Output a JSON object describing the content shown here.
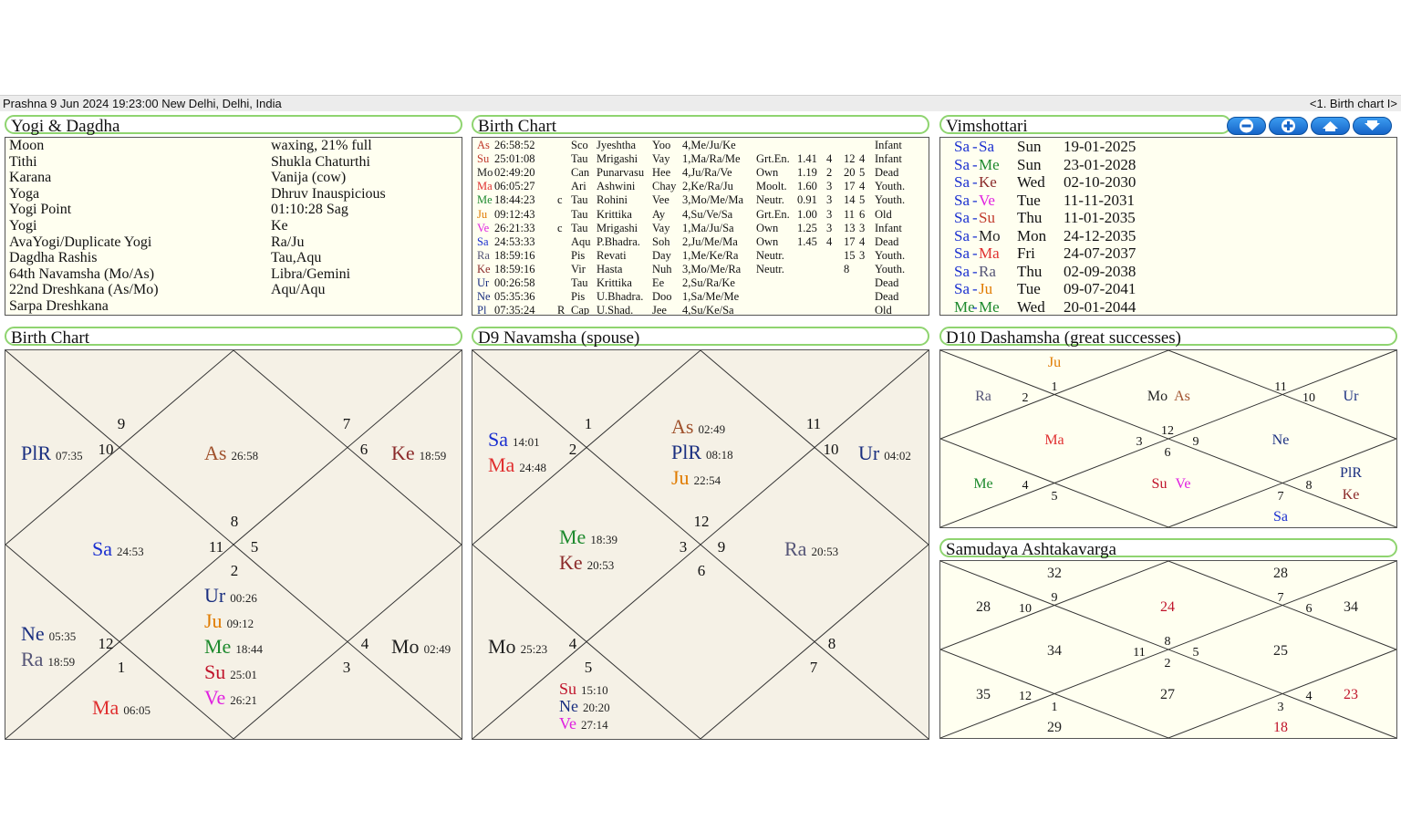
{
  "status": {
    "left": "Prashna 9 Jun 2024 19:23:00  New Delhi, Delhi, India",
    "right": "<1. Birth chart I>"
  },
  "yogi": {
    "title": "Yogi & Dagdha",
    "rows": [
      {
        "label": "Moon",
        "value": "waxing, 21% full"
      },
      {
        "label": "Tithi",
        "value": "Shukla Chaturthi"
      },
      {
        "label": "Karana",
        "value": "Vanija (cow)"
      },
      {
        "label": "Yoga",
        "value": "Dhruv Inauspicious"
      },
      {
        "label": "Yogi Point",
        "value": "01:10:28 Sag"
      },
      {
        "label": "Yogi",
        "value": "Ke"
      },
      {
        "label": "AvaYogi/Duplicate Yogi",
        "value": "Ra/Ju"
      },
      {
        "label": "Dagdha Rashis",
        "value": "Tau,Aqu"
      },
      {
        "label": "64th Navamsha (Mo/As)",
        "value": "Libra/Gemini"
      },
      {
        "label": "22nd Dreshkana (As/Mo)",
        "value": "Aqu/Aqu"
      },
      {
        "label": "Sarpa Dreshkana",
        "value": ""
      }
    ]
  },
  "birth_table": {
    "title": "Birth Chart",
    "rows": [
      {
        "p": "As",
        "c": "#c0392b",
        "deg": "26:58:52",
        "r": "",
        "sign": "Sco",
        "nak": "Jyeshtha",
        "syl": "Yoo",
        "pada": "4,Me/Ju/Ke",
        "dig": "",
        "s1": "",
        "s2": "",
        "s3": "",
        "s4": "",
        "av": "Infant"
      },
      {
        "p": "Su",
        "c": "#c0392b",
        "deg": "25:01:08",
        "r": "",
        "sign": "Tau",
        "nak": "Mrigashi",
        "syl": "Vay",
        "pada": "1,Ma/Ra/Me",
        "dig": "Grt.En.",
        "s1": "1.41",
        "s2": "4",
        "s3": "12",
        "s4": "4",
        "av": "Infant"
      },
      {
        "p": "Mo",
        "c": "#222222",
        "deg": "02:49:20",
        "r": "",
        "sign": "Can",
        "nak": "Punarvasu",
        "syl": "Hee",
        "pada": "4,Ju/Ra/Ve",
        "dig": "Own",
        "s1": "1.19",
        "s2": "2",
        "s3": "20",
        "s4": "5",
        "av": "Dead"
      },
      {
        "p": "Ma",
        "c": "#e03030",
        "deg": "06:05:27",
        "r": "",
        "sign": "Ari",
        "nak": "Ashwini",
        "syl": "Chay",
        "pada": "2,Ke/Ra/Ju",
        "dig": "Moolt.",
        "s1": "1.60",
        "s2": "3",
        "s3": "17",
        "s4": "4",
        "av": "Youth."
      },
      {
        "p": "Me",
        "c": "#1e8a2e",
        "deg": "18:44:23",
        "r": "c",
        "sign": "Tau",
        "nak": "Rohini",
        "syl": "Vee",
        "pada": "3,Mo/Me/Ma",
        "dig": "Neutr.",
        "s1": "0.91",
        "s2": "3",
        "s3": "14",
        "s4": "5",
        "av": "Youth."
      },
      {
        "p": "Ju",
        "c": "#e07b00",
        "deg": "09:12:43",
        "r": "",
        "sign": "Tau",
        "nak": "Krittika",
        "syl": "Ay",
        "pada": "4,Su/Ve/Sa",
        "dig": "Grt.En.",
        "s1": "1.00",
        "s2": "3",
        "s3": "11",
        "s4": "6",
        "av": "Old"
      },
      {
        "p": "Ve",
        "c": "#e020e0",
        "deg": "26:21:33",
        "r": "c",
        "sign": "Tau",
        "nak": "Mrigashi",
        "syl": "Vay",
        "pada": "1,Ma/Ju/Sa",
        "dig": "Own",
        "s1": "1.25",
        "s2": "3",
        "s3": "13",
        "s4": "3",
        "av": "Infant"
      },
      {
        "p": "Sa",
        "c": "#1a2fd0",
        "deg": "24:53:33",
        "r": "",
        "sign": "Aqu",
        "nak": "P.Bhadra.",
        "syl": "Soh",
        "pada": "2,Ju/Me/Ma",
        "dig": "Own",
        "s1": "1.45",
        "s2": "4",
        "s3": "17",
        "s4": "4",
        "av": "Dead"
      },
      {
        "p": "Ra",
        "c": "#555577",
        "deg": "18:59:16",
        "r": "",
        "sign": "Pis",
        "nak": "Revati",
        "syl": "Day",
        "pada": "1,Me/Ke/Ra",
        "dig": "Neutr.",
        "s1": "",
        "s2": "",
        "s3": "15",
        "s4": "3",
        "av": "Youth."
      },
      {
        "p": "Ke",
        "c": "#8b2a2a",
        "deg": "18:59:16",
        "r": "",
        "sign": "Vir",
        "nak": "Hasta",
        "syl": "Nuh",
        "pada": "3,Mo/Me/Ra",
        "dig": "Neutr.",
        "s1": "",
        "s2": "",
        "s3": "8",
        "s4": "",
        "av": "Youth."
      },
      {
        "p": "Ur",
        "c": "#1a2f80",
        "deg": "00:26:58",
        "r": "",
        "sign": "Tau",
        "nak": "Krittika",
        "syl": "Ee",
        "pada": "2,Su/Ra/Ke",
        "dig": "",
        "s1": "",
        "s2": "",
        "s3": "",
        "s4": "",
        "av": "Dead"
      },
      {
        "p": "Ne",
        "c": "#1a2f80",
        "deg": "05:35:36",
        "r": "",
        "sign": "Pis",
        "nak": "U.Bhadra.",
        "syl": "Doo",
        "pada": "1,Sa/Me/Me",
        "dig": "",
        "s1": "",
        "s2": "",
        "s3": "",
        "s4": "",
        "av": "Dead"
      },
      {
        "p": "Pl",
        "c": "#1a2f80",
        "deg": "07:35:24",
        "r": "R",
        "sign": "Cap",
        "nak": "U.Shad.",
        "syl": "Jee",
        "pada": "4,Su/Ke/Sa",
        "dig": "",
        "s1": "",
        "s2": "",
        "s3": "",
        "s4": "",
        "av": "Old"
      }
    ]
  },
  "vims": {
    "title": "Vimshottari",
    "buttons": [
      "minus-icon",
      "plus-icon",
      "arrow-up-icon",
      "arrow-down-icon"
    ],
    "rows": [
      {
        "a": "Sa",
        "ac": "#1a2fd0",
        "b": "Sa",
        "bc": "#1a2fd0",
        "day": "Sun",
        "date": "19-01-2025"
      },
      {
        "a": "Sa",
        "ac": "#1a2fd0",
        "b": "Me",
        "bc": "#1e8a2e",
        "day": "Sun",
        "date": "23-01-2028"
      },
      {
        "a": "Sa",
        "ac": "#1a2fd0",
        "b": "Ke",
        "bc": "#8b2a2a",
        "day": "Wed",
        "date": "02-10-2030"
      },
      {
        "a": "Sa",
        "ac": "#1a2fd0",
        "b": "Ve",
        "bc": "#e020e0",
        "day": "Tue",
        "date": "11-11-2031"
      },
      {
        "a": "Sa",
        "ac": "#1a2fd0",
        "b": "Su",
        "bc": "#c0392b",
        "day": "Thu",
        "date": "11-01-2035"
      },
      {
        "a": "Sa",
        "ac": "#1a2fd0",
        "b": "Mo",
        "bc": "#222222",
        "day": "Mon",
        "date": "24-12-2035"
      },
      {
        "a": "Sa",
        "ac": "#1a2fd0",
        "b": "Ma",
        "bc": "#e03030",
        "day": "Fri",
        "date": "24-07-2037"
      },
      {
        "a": "Sa",
        "ac": "#1a2fd0",
        "b": "Ra",
        "bc": "#555577",
        "day": "Thu",
        "date": "02-09-2038"
      },
      {
        "a": "Sa",
        "ac": "#1a2fd0",
        "b": "Ju",
        "bc": "#e07b00",
        "day": "Tue",
        "date": "09-07-2041"
      },
      {
        "a": "Me",
        "ac": "#1e8a2e",
        "b": "Me",
        "bc": "#1e8a2e",
        "day": "Wed",
        "date": "20-01-2044"
      }
    ]
  },
  "birth_chart": {
    "title": "Birth Chart",
    "signs": [
      "9",
      "10",
      "7",
      "6",
      "8",
      "11",
      "5",
      "2",
      "12",
      "1",
      "4",
      "3",
      "8"
    ],
    "planets": [
      {
        "n": "PlR",
        "d": "07:35",
        "c": "#1a2f80"
      },
      {
        "n": "As",
        "d": "26:58",
        "c": "#a0522d"
      },
      {
        "n": "Ke",
        "d": "18:59",
        "c": "#8b2a2a"
      },
      {
        "n": "Sa",
        "d": "24:53",
        "c": "#1a2fd0"
      },
      {
        "n": "Ur",
        "d": "00:26",
        "c": "#1a2f80"
      },
      {
        "n": "Ju",
        "d": "09:12",
        "c": "#e07b00"
      },
      {
        "n": "Me",
        "d": "18:44",
        "c": "#1e8a2e"
      },
      {
        "n": "Su",
        "d": "25:01",
        "c": "#c0142b"
      },
      {
        "n": "Ve",
        "d": "26:21",
        "c": "#e020e0"
      },
      {
        "n": "Ne",
        "d": "05:35",
        "c": "#1a2f80"
      },
      {
        "n": "Ra",
        "d": "18:59",
        "c": "#555577"
      },
      {
        "n": "Mo",
        "d": "02:49",
        "c": "#222222"
      },
      {
        "n": "Ma",
        "d": "06:05",
        "c": "#e03030"
      }
    ]
  },
  "navamsha": {
    "title": "D9 Navamsha  (spouse)",
    "signs": [
      "1",
      "2",
      "11",
      "10",
      "12",
      "3",
      "9",
      "6",
      "4",
      "5",
      "8",
      "7"
    ],
    "planets": [
      {
        "n": "Sa",
        "d": "14:01",
        "c": "#1a2fd0"
      },
      {
        "n": "Ma",
        "d": "24:48",
        "c": "#e03030"
      },
      {
        "n": "As",
        "d": "02:49",
        "c": "#a0522d"
      },
      {
        "n": "PlR",
        "d": "08:18",
        "c": "#1a2f80"
      },
      {
        "n": "Ju",
        "d": "22:54",
        "c": "#e07b00"
      },
      {
        "n": "Ur",
        "d": "04:02",
        "c": "#1a2f80"
      },
      {
        "n": "Me",
        "d": "18:39",
        "c": "#1e8a2e"
      },
      {
        "n": "Ke",
        "d": "20:53",
        "c": "#8b2a2a"
      },
      {
        "n": "Ra",
        "d": "20:53",
        "c": "#555577"
      },
      {
        "n": "Mo",
        "d": "25:23",
        "c": "#222222"
      },
      {
        "n": "Su",
        "d": "15:10",
        "c": "#c0142b"
      },
      {
        "n": "Ne",
        "d": "20:20",
        "c": "#1a2f80"
      },
      {
        "n": "Ve",
        "d": "27:14",
        "c": "#e020e0"
      }
    ]
  },
  "dashamsha": {
    "title": "D10 Dashamsha  (great successes)",
    "signs": [
      "1",
      "2",
      "11",
      "10",
      "12",
      "3",
      "9",
      "6",
      "4",
      "5",
      "8",
      "7"
    ],
    "planets": [
      {
        "n": "Ju",
        "c": "#e07b00"
      },
      {
        "n": "Ra",
        "c": "#555577"
      },
      {
        "n": "Mo",
        "c": "#222222"
      },
      {
        "n": "As",
        "c": "#a0522d"
      },
      {
        "n": "Ur",
        "c": "#1a2f80"
      },
      {
        "n": "Ma",
        "c": "#e03030"
      },
      {
        "n": "Ne",
        "c": "#1a2f80"
      },
      {
        "n": "Me",
        "c": "#1e8a2e"
      },
      {
        "n": "Su",
        "c": "#c0142b"
      },
      {
        "n": "Ve",
        "c": "#e020e0"
      },
      {
        "n": "PlR",
        "c": "#1a2f80"
      },
      {
        "n": "Ke",
        "c": "#8b2a2a"
      },
      {
        "n": "Sa",
        "c": "#1a2fd0"
      }
    ]
  },
  "ashtaka": {
    "title": "Samudaya Ashtakavarga",
    "signs": [
      "9",
      "10",
      "7",
      "6",
      "8",
      "11",
      "5",
      "2",
      "12",
      "1",
      "4",
      "3"
    ],
    "scores": [
      "32",
      "28",
      "28",
      "24",
      "34",
      "34",
      "25",
      "35",
      "27",
      "23",
      "29",
      "18"
    ],
    "score_colors": {
      "normal": "#222222",
      "high": "#c0142b"
    }
  }
}
